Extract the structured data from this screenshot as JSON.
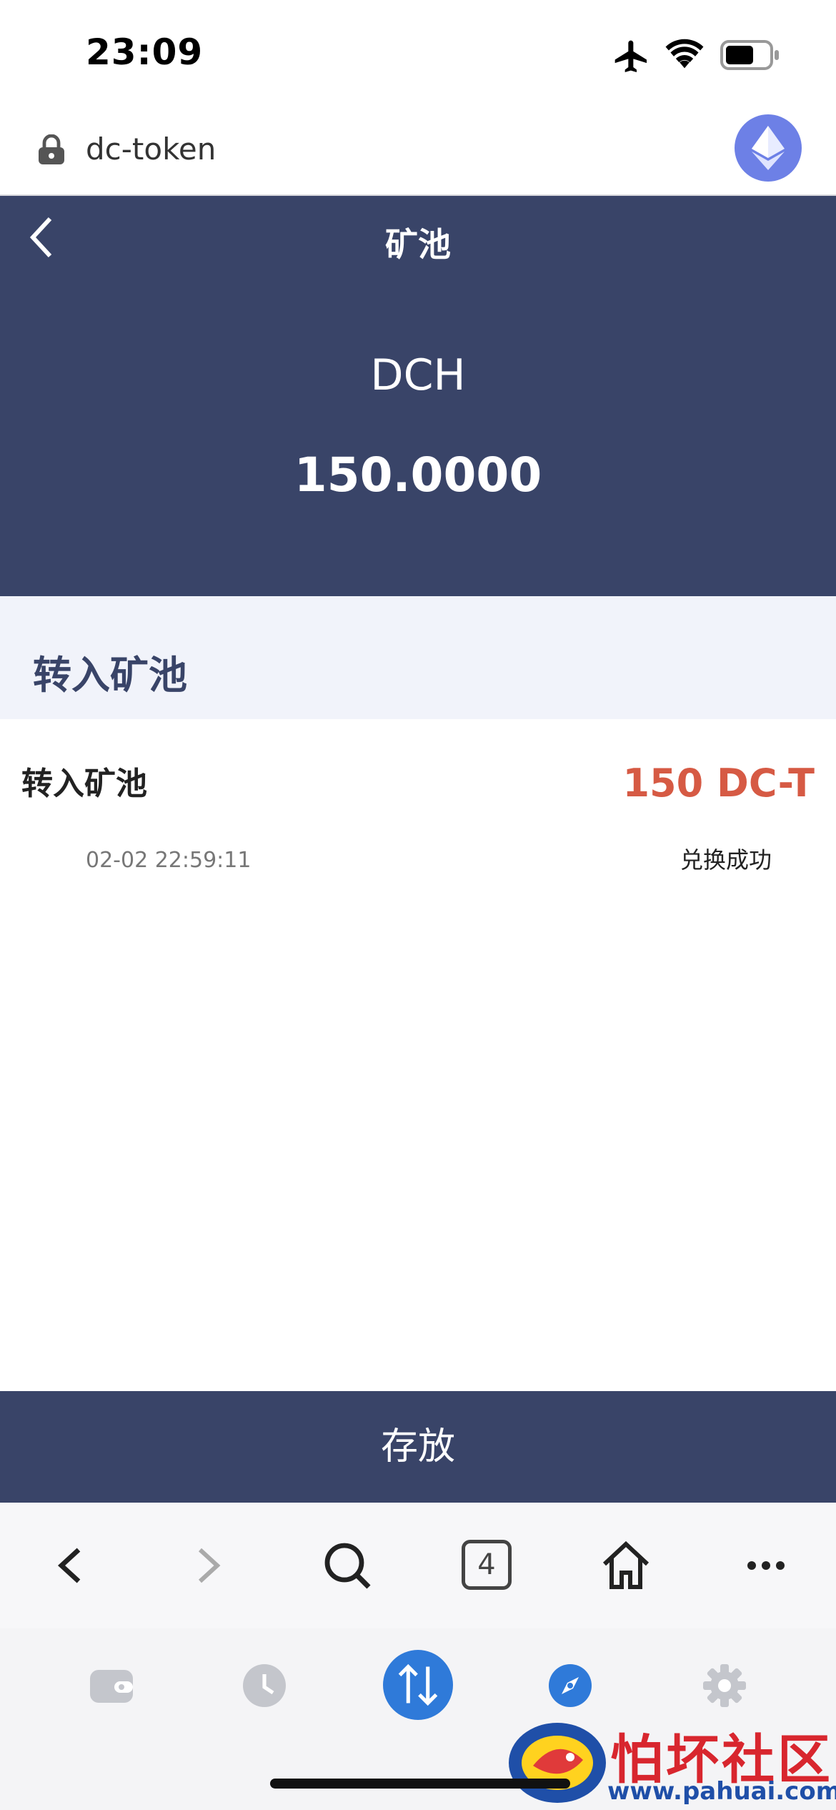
{
  "status_bar": {
    "time": "23:09"
  },
  "browser": {
    "url": "dc-token",
    "tab_count": "4"
  },
  "header": {
    "title": "矿池",
    "token": "DCH",
    "balance": "150.0000"
  },
  "section": {
    "title": "转入矿池"
  },
  "record": {
    "title": "转入矿池",
    "amount": "150 DC-T",
    "time": "02-02 22:59:11",
    "status": "兑换成功"
  },
  "deposit_button": {
    "label": "存放"
  },
  "watermark": {
    "text": "怕坏社区",
    "url": "www.pahuai.com"
  },
  "colors": {
    "header_bg": "#394468",
    "amount_red": "#d65a44",
    "section_bg": "#f1f3fa"
  }
}
